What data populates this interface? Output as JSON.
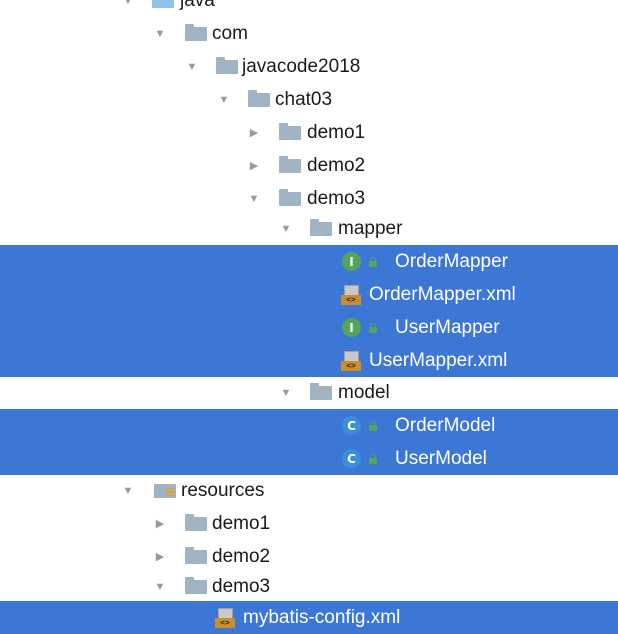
{
  "tree": {
    "java": {
      "label": "java",
      "expanded": true
    },
    "com": {
      "label": "com",
      "expanded": true
    },
    "javacode2018": {
      "label": "javacode2018",
      "expanded": true
    },
    "chat03": {
      "label": "chat03",
      "expanded": true
    },
    "chat03_demo1": {
      "label": "demo1",
      "expanded": false
    },
    "chat03_demo2": {
      "label": "demo2",
      "expanded": false
    },
    "chat03_demo3": {
      "label": "demo3",
      "expanded": true
    },
    "mapper": {
      "label": "mapper",
      "expanded": true
    },
    "order_mapper": {
      "label": "OrderMapper",
      "icon": "interface-icon",
      "badge": "I",
      "selected": true
    },
    "order_mapper_xml": {
      "label": "OrderMapper.xml",
      "icon": "xml-file-icon",
      "selected": true
    },
    "user_mapper": {
      "label": "UserMapper",
      "icon": "interface-icon",
      "badge": "I",
      "selected": true
    },
    "user_mapper_xml": {
      "label": "UserMapper.xml",
      "icon": "xml-file-icon",
      "selected": true
    },
    "model": {
      "label": "model",
      "expanded": true
    },
    "order_model": {
      "label": "OrderModel",
      "icon": "class-icon",
      "badge": "C",
      "selected": true
    },
    "user_model": {
      "label": "UserModel",
      "icon": "class-icon",
      "badge": "C",
      "selected": true
    },
    "resources": {
      "label": "resources",
      "expanded": true
    },
    "res_demo1": {
      "label": "demo1",
      "expanded": false
    },
    "res_demo2": {
      "label": "demo2",
      "expanded": false
    },
    "res_demo3": {
      "label": "demo3",
      "expanded": true
    },
    "mybatis_config": {
      "label": "mybatis-config.xml",
      "icon": "xml-file-icon",
      "selected": true
    }
  },
  "colors": {
    "selection": "#3d77d6",
    "folder": "#9fb3c2",
    "source_folder": "#8ec3ea",
    "interface_badge": "#56a35b",
    "class_badge": "#3b8fd9",
    "xml_tag": "#c98f2c"
  }
}
